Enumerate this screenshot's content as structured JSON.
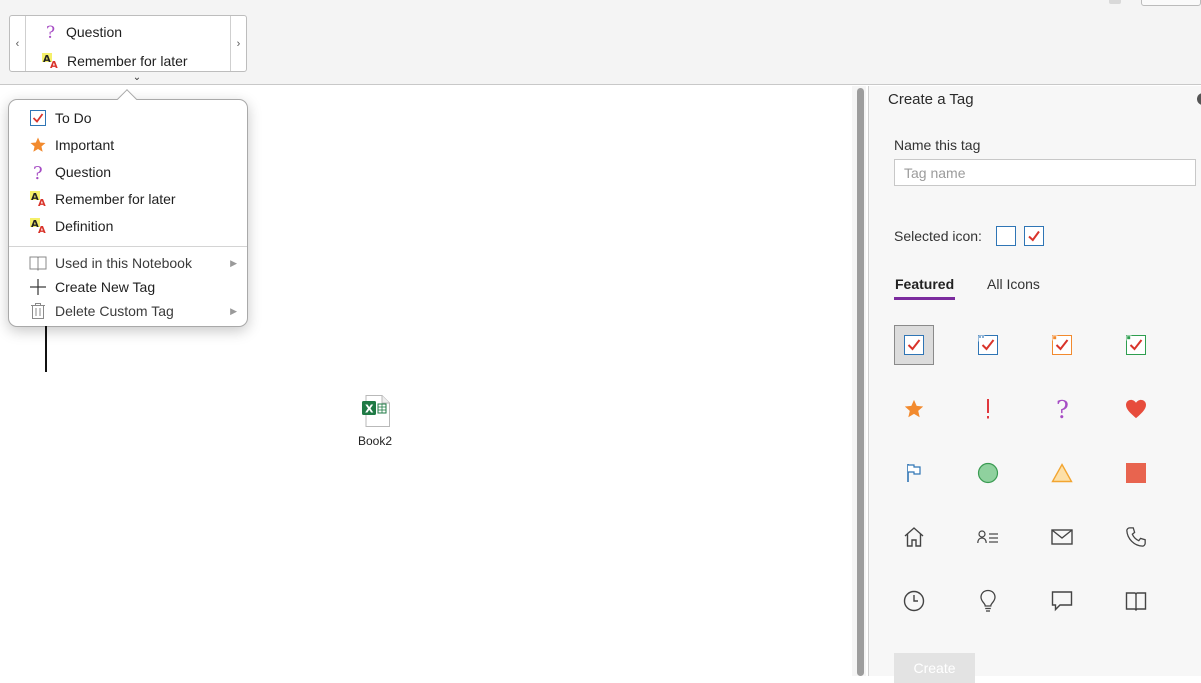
{
  "ribbon": {
    "gallery": {
      "prev_label": "‹",
      "next_label": "›",
      "expand_label": "⌄",
      "items": [
        {
          "label": "Question",
          "icon": "question-icon"
        },
        {
          "label": "Remember for later",
          "icon": "highlight-a-icon"
        }
      ]
    }
  },
  "menu": {
    "tags": [
      {
        "label": "To Do",
        "icon": "todo-checkbox-icon"
      },
      {
        "label": "Important",
        "icon": "star-icon"
      },
      {
        "label": "Question",
        "icon": "question-icon"
      },
      {
        "label": "Remember for later",
        "icon": "highlight-a-icon"
      },
      {
        "label": "Definition",
        "icon": "highlight-a-icon"
      }
    ],
    "actions": [
      {
        "label": "Used in this Notebook",
        "icon": "notebook-icon",
        "submenu_arrow": "▶"
      },
      {
        "label": "Create New Tag",
        "icon": "plus-icon"
      },
      {
        "label": "Delete Custom Tag",
        "icon": "trash-icon",
        "submenu_arrow": "▶"
      }
    ]
  },
  "canvas": {
    "attachment_name": "Book2",
    "attachment_badge": "X"
  },
  "pane": {
    "title": "Create a Tag",
    "name_label": "Name this tag",
    "name_placeholder": "Tag name",
    "name_value": "",
    "selected_icon_label": "Selected icon:",
    "tabs": {
      "featured": "Featured",
      "all": "All Icons"
    },
    "create_label": "Create",
    "icons": [
      "checkbox-check-blue-icon",
      "checkbox-check-blue-dots-icon",
      "checkbox-check-orange-icon",
      "checkbox-check-green-icon",
      "star-icon",
      "exclamation-icon",
      "question-icon",
      "heart-icon",
      "flag-icon",
      "green-circle-icon",
      "triangle-icon",
      "red-square-icon",
      "home-icon",
      "contact-icon",
      "mail-icon",
      "phone-icon",
      "clock-icon",
      "lightbulb-icon",
      "speech-bubble-icon",
      "book-icon"
    ]
  },
  "colors": {
    "accent_tab": "#7b2b9e",
    "check_red": "#d9342b",
    "check_box_blue": "#2f75b5",
    "star_orange": "#f28a2e",
    "heart_red": "#e74c3c",
    "question_purple": "#a64cc4"
  }
}
